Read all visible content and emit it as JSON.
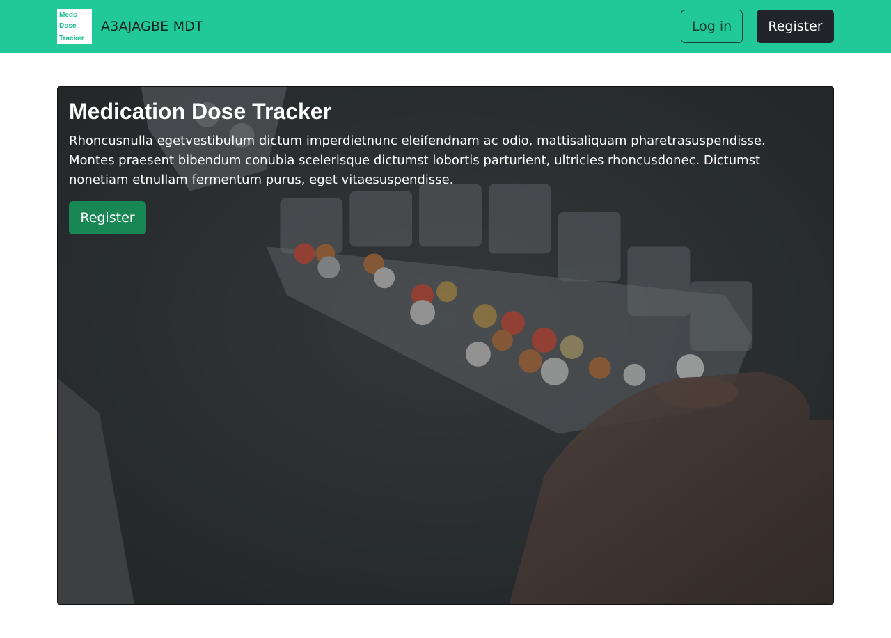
{
  "navbar": {
    "logo_lines": [
      "Meds",
      "Dose",
      "Tracker"
    ],
    "brand_name": "A3AJAGBE MDT",
    "login_label": "Log in",
    "register_label": "Register"
  },
  "hero": {
    "title": "Medication Dose Tracker",
    "text": "Rhoncusnulla egetvestibulum dictum imperdietnunc eleifendnam ac odio, mattisaliquam pharetrasuspendisse. Montes praesent bibendum conubia scelerisque dictumst lobortis parturient, ultricies rhoncusdonec. Dictumst nonetiam etnullam fermentum purus, eget vitaesuspendisse.",
    "register_label": "Register"
  },
  "colors": {
    "navbar_bg": "#20c997",
    "dark_button": "#212529",
    "success_button": "#198754"
  }
}
